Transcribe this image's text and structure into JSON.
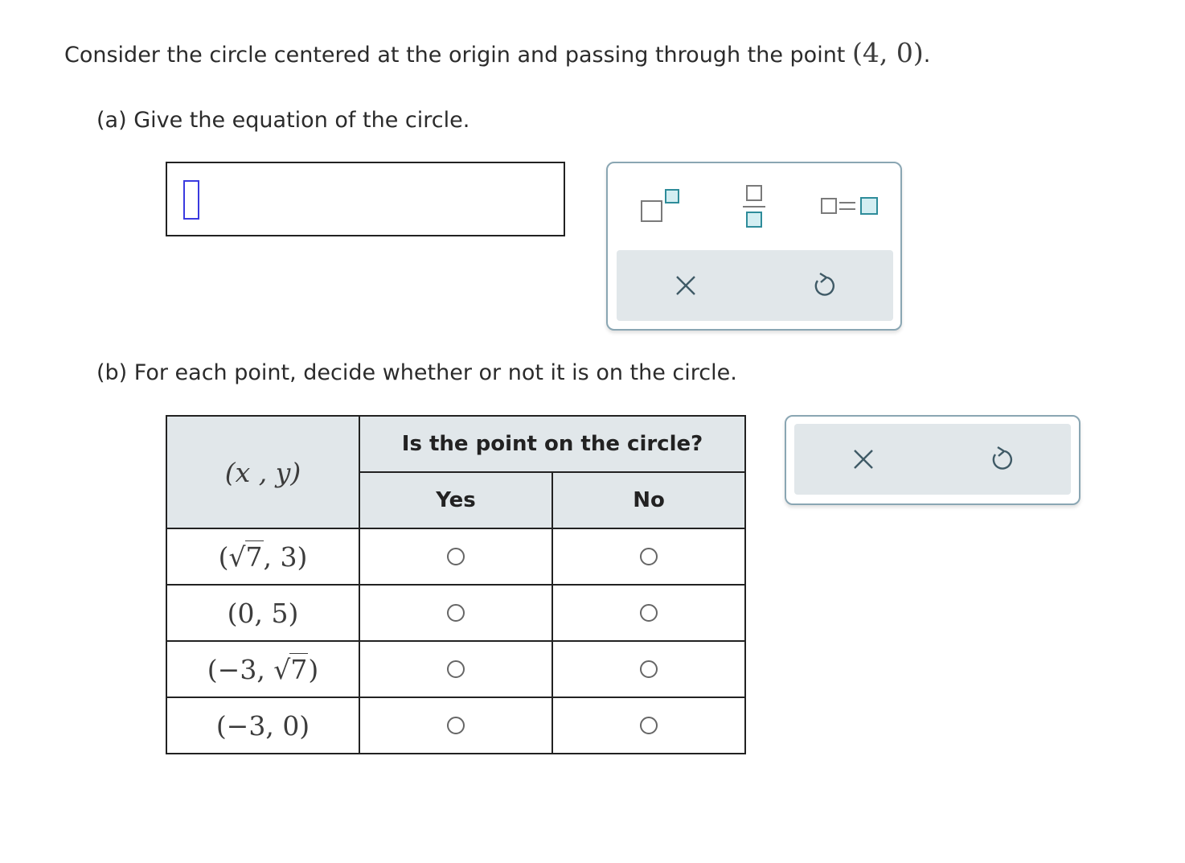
{
  "intro": {
    "text": "Consider the circle centered at the origin and passing through the point ",
    "point": "(4,  0)",
    "end": "."
  },
  "part_a": {
    "label": "(a) Give the equation of the circle."
  },
  "answer_box": {
    "value": ""
  },
  "palette_a": {
    "tools": [
      "superscript-template",
      "fraction-template",
      "equation-template"
    ],
    "actions": [
      "clear",
      "undo"
    ]
  },
  "part_b": {
    "label": "(b) For each point, decide whether or not it is on the circle."
  },
  "table": {
    "point_header": "(x , y)",
    "question_header": "Is the point on the circle?",
    "yes_header": "Yes",
    "no_header": "No",
    "rows": [
      {
        "open": "(",
        "sqrt_first": "7",
        "rest": ", 3)"
      },
      {
        "text": "(0,  5)"
      },
      {
        "lead": "(−3,  ",
        "sqrt_second": "7",
        "close": ")"
      },
      {
        "text": "(−3,  0)"
      }
    ],
    "selected": [
      null,
      null,
      null,
      null
    ]
  },
  "palette_b": {
    "actions": [
      "clear",
      "undo"
    ]
  },
  "colors": {
    "palette_border": "#8aa6b3",
    "tool_bg": "#e1e7ea",
    "accent_teal": "#2e8c9a",
    "caret": "#3a3adf"
  }
}
